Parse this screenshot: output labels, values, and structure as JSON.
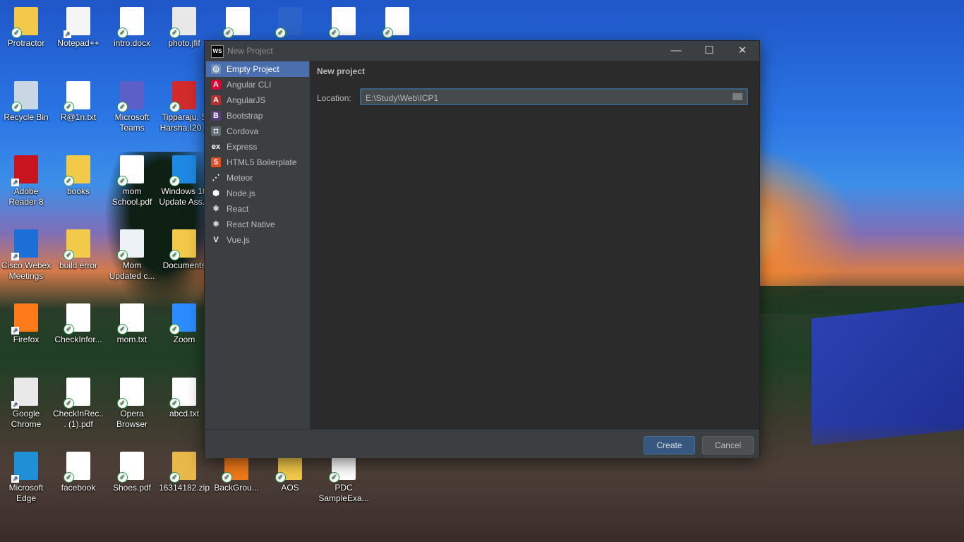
{
  "desktop": {
    "icons": [
      {
        "label": "Protractor"
      },
      {
        "label": "Notepad++"
      },
      {
        "label": "intro.docx"
      },
      {
        "label": "photo.jfif"
      },
      {
        "label": ""
      },
      {
        "label": ""
      },
      {
        "label": ""
      },
      {
        "label": ""
      },
      {
        "label": "Recycle Bin"
      },
      {
        "label": "R@1n.txt"
      },
      {
        "label": "Microsoft Teams"
      },
      {
        "label": "Tipparaju, S Harsha.I20..."
      },
      {
        "label": "Adobe Reader 8"
      },
      {
        "label": "books"
      },
      {
        "label": "mom School.pdf"
      },
      {
        "label": "Windows 10 Update Ass..."
      },
      {
        "label": "Cisco Webex Meetings"
      },
      {
        "label": "build error"
      },
      {
        "label": "Mom Updated c..."
      },
      {
        "label": "Documents"
      },
      {
        "label": "Firefox"
      },
      {
        "label": "CheckInfor..."
      },
      {
        "label": "mom.txt"
      },
      {
        "label": "Zoom"
      },
      {
        "label": "Google Chrome"
      },
      {
        "label": "CheckInRec... (1).pdf"
      },
      {
        "label": "Opera Browser"
      },
      {
        "label": "abcd.txt"
      },
      {
        "label": "Microsoft Edge"
      },
      {
        "label": "facebook"
      },
      {
        "label": "Shoes.pdf"
      },
      {
        "label": "16314182.zip"
      },
      {
        "label": "BackGrou..."
      },
      {
        "label": "AOS"
      },
      {
        "label": "PDC SampleExa..."
      }
    ]
  },
  "dialog": {
    "logo_text": "WS",
    "title": "New Project",
    "minimize": "—",
    "maximize": "☐",
    "close": "✕",
    "sidebar": {
      "items": [
        {
          "label": "Empty Project",
          "icon": "globe-icon",
          "glyph": "◎",
          "color": "#6b8cb5"
        },
        {
          "label": "Angular CLI",
          "icon": "angular-icon",
          "glyph": "A",
          "color": "#dd0031"
        },
        {
          "label": "AngularJS",
          "icon": "angularjs-icon",
          "glyph": "A",
          "color": "#b52e31"
        },
        {
          "label": "Bootstrap",
          "icon": "bootstrap-icon",
          "glyph": "B",
          "color": "#563d7c"
        },
        {
          "label": "Cordova",
          "icon": "cordova-icon",
          "glyph": "◘",
          "color": "#5f6a72"
        },
        {
          "label": "Express",
          "icon": "express-icon",
          "glyph": "ex",
          "color": "#3c3f41"
        },
        {
          "label": "HTML5 Boilerplate",
          "icon": "html5-icon",
          "glyph": "5",
          "color": "#e44d26"
        },
        {
          "label": "Meteor",
          "icon": "meteor-icon",
          "glyph": "⋰",
          "color": "#3c3f41"
        },
        {
          "label": "Node.js",
          "icon": "nodejs-icon",
          "glyph": "⬢",
          "color": "#3c3f41"
        },
        {
          "label": "React",
          "icon": "react-icon",
          "glyph": "⚛",
          "color": "#3c3f41"
        },
        {
          "label": "React Native",
          "icon": "react-native-icon",
          "glyph": "⚛",
          "color": "#3c3f41"
        },
        {
          "label": "Vue.js",
          "icon": "vue-icon",
          "glyph": "V",
          "color": "#3c3f41"
        }
      ]
    },
    "content": {
      "heading": "New project",
      "location_label": "Location:",
      "location_value": "E:\\Study\\Web\\ICP1"
    },
    "buttons": {
      "create": "Create",
      "cancel": "Cancel"
    }
  }
}
